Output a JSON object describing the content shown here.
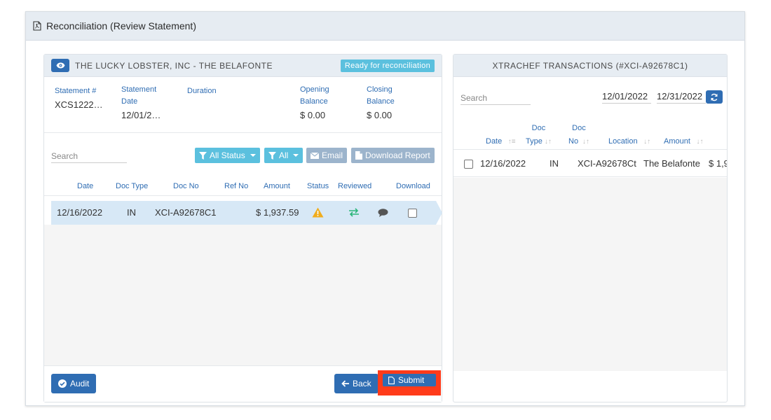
{
  "window": {
    "title": "Reconciliation (Review Statement)"
  },
  "statement_panel": {
    "vendor": "THE LUCKY LOBSTER, INC - THE BELAFONTE",
    "status_badge": "Ready for reconciliation",
    "info": {
      "statement_no_label": "Statement #",
      "statement_no": "XCS1222…",
      "statement_date_label_1": "Statement",
      "statement_date_label_2": "Date",
      "statement_date": "12/01/2…",
      "duration_label": "Duration",
      "opening_label_1": "Opening",
      "opening_label_2": "Balance",
      "opening_balance": "$ 0.00",
      "closing_label_1": "Closing",
      "closing_label_2": "Balance",
      "closing_balance": "$ 0.00"
    },
    "search_placeholder": "Search",
    "buttons": {
      "all_status": "All Status",
      "all": "All",
      "email": "Email",
      "download_report": "Download Report"
    },
    "columns": [
      "Date",
      "Doc Type",
      "Doc No",
      "Ref No",
      "Amount",
      "Status",
      "Reviewed",
      "Download"
    ],
    "rows": [
      {
        "date": "12/16/2022",
        "doc_type": "IN",
        "doc_no": "XCI-A92678C1",
        "amount": "$ 1,937.59"
      }
    ],
    "footer": {
      "audit": "Audit",
      "back": "Back",
      "submit": "Submit"
    }
  },
  "transactions_panel": {
    "title": "XTRACHEF TRANSACTIONS (#XCI-A92678C1)",
    "search_placeholder": "Search",
    "date_from": "12/01/2022",
    "date_to": "12/31/2022",
    "columns": {
      "date": "Date",
      "doc_type_1": "Doc",
      "doc_type_2": "Type",
      "doc_no_1": "Doc",
      "doc_no_2": "No",
      "location": "Location",
      "amount": "Amount"
    },
    "rows": [
      {
        "date": "12/16/2022",
        "doc_type": "IN",
        "doc_no": "XCI-A92678Ct",
        "location": "The Belafonte",
        "amount": "$ 1,9"
      }
    ]
  },
  "colors": {
    "primary": "#2f6db3",
    "info": "#5bc0de",
    "warning": "#f0ad1e",
    "success": "#2bb57a",
    "highlight": "#ff3b1a"
  }
}
